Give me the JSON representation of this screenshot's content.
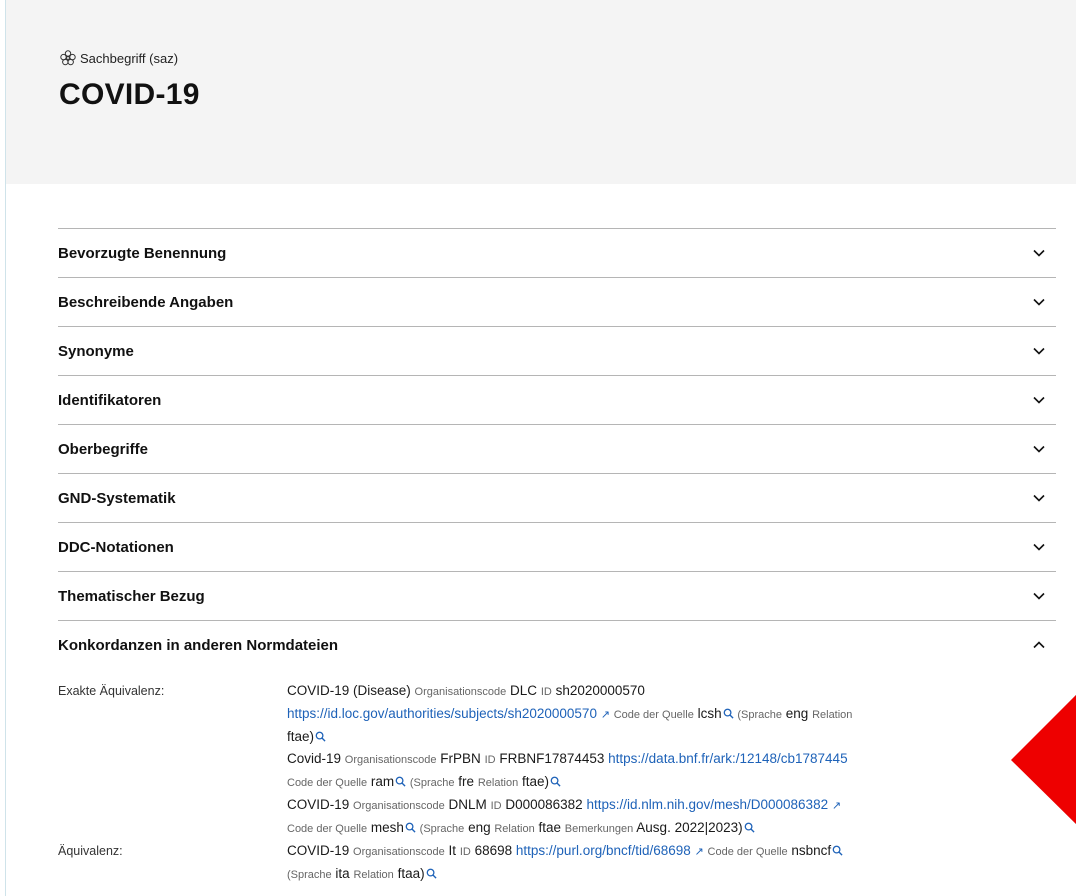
{
  "header": {
    "entity_type": "Sachbegriff (saz)",
    "title": "COVID-19"
  },
  "sections": [
    {
      "label": "Bevorzugte Benennung",
      "expanded": false
    },
    {
      "label": "Beschreibende Angaben",
      "expanded": false
    },
    {
      "label": "Synonyme",
      "expanded": false
    },
    {
      "label": "Identifikatoren",
      "expanded": false
    },
    {
      "label": "Oberbegriffe",
      "expanded": false
    },
    {
      "label": "GND-Systematik",
      "expanded": false
    },
    {
      "label": "DDC-Notationen",
      "expanded": false
    },
    {
      "label": "Thematischer Bezug",
      "expanded": false
    },
    {
      "label": "Konkordanzen in anderen Normdateien",
      "expanded": true
    }
  ],
  "concordances": {
    "exact_label": "Exakte Äquivalenz:",
    "equiv_label": "Äquivalenz:",
    "exact": [
      {
        "name": "COVID-19 (Disease)",
        "org_label": "Organisationscode",
        "org": "DLC",
        "id_label": "ID",
        "id": "sh2020000570",
        "url": "https://id.loc.gov/authorities/subjects/sh2020000570",
        "source_label": "Code der Quelle",
        "source": "lcsh",
        "lang_label": "(Sprache",
        "lang": "eng",
        "rel_label": "Relation",
        "rel": "ftae)"
      },
      {
        "name": "Covid-19",
        "org_label": "Organisationscode",
        "org": "FrPBN",
        "id_label": "ID",
        "id": "FRBNF17874453",
        "url": "https://data.bnf.fr/ark:/12148/cb1787445",
        "source_label": "Code der Quelle",
        "source": "ram",
        "lang_label": "(Sprache",
        "lang": "fre",
        "rel_label": "Relation",
        "rel": "ftae)"
      },
      {
        "name": "COVID-19",
        "org_label": "Organisationscode",
        "org": "DNLM",
        "id_label": "ID",
        "id": "D000086382",
        "url": "https://id.nlm.nih.gov/mesh/D000086382",
        "source_label": "Code der Quelle",
        "source": "mesh",
        "lang_label": "(Sprache",
        "lang": "eng",
        "rel_label": "Relation",
        "rel": "ftae",
        "remarks_label": "Bemerkungen",
        "remarks": "Ausg. 2022|2023)"
      }
    ],
    "equiv": [
      {
        "name": "COVID-19",
        "org_label": "Organisationscode",
        "org": "It",
        "id_label": "ID",
        "id": "68698",
        "url": "https://purl.org/bncf/tid/68698",
        "source_label": "Code der Quelle",
        "source": "nsbncf",
        "lang_label": "(Sprache",
        "lang": "ita",
        "rel_label": "Relation",
        "rel": "ftaa)"
      }
    ]
  },
  "colors": {
    "link": "#1e62b8",
    "header_bg": "#f4f4f4",
    "pointer_arrow": "#e60000"
  },
  "icons": {
    "entity_type": "sachbegriff-icon",
    "collapsed": "chevron-down-icon",
    "expanded": "chevron-up-icon",
    "search": "search-icon",
    "external": "external-link-icon"
  }
}
